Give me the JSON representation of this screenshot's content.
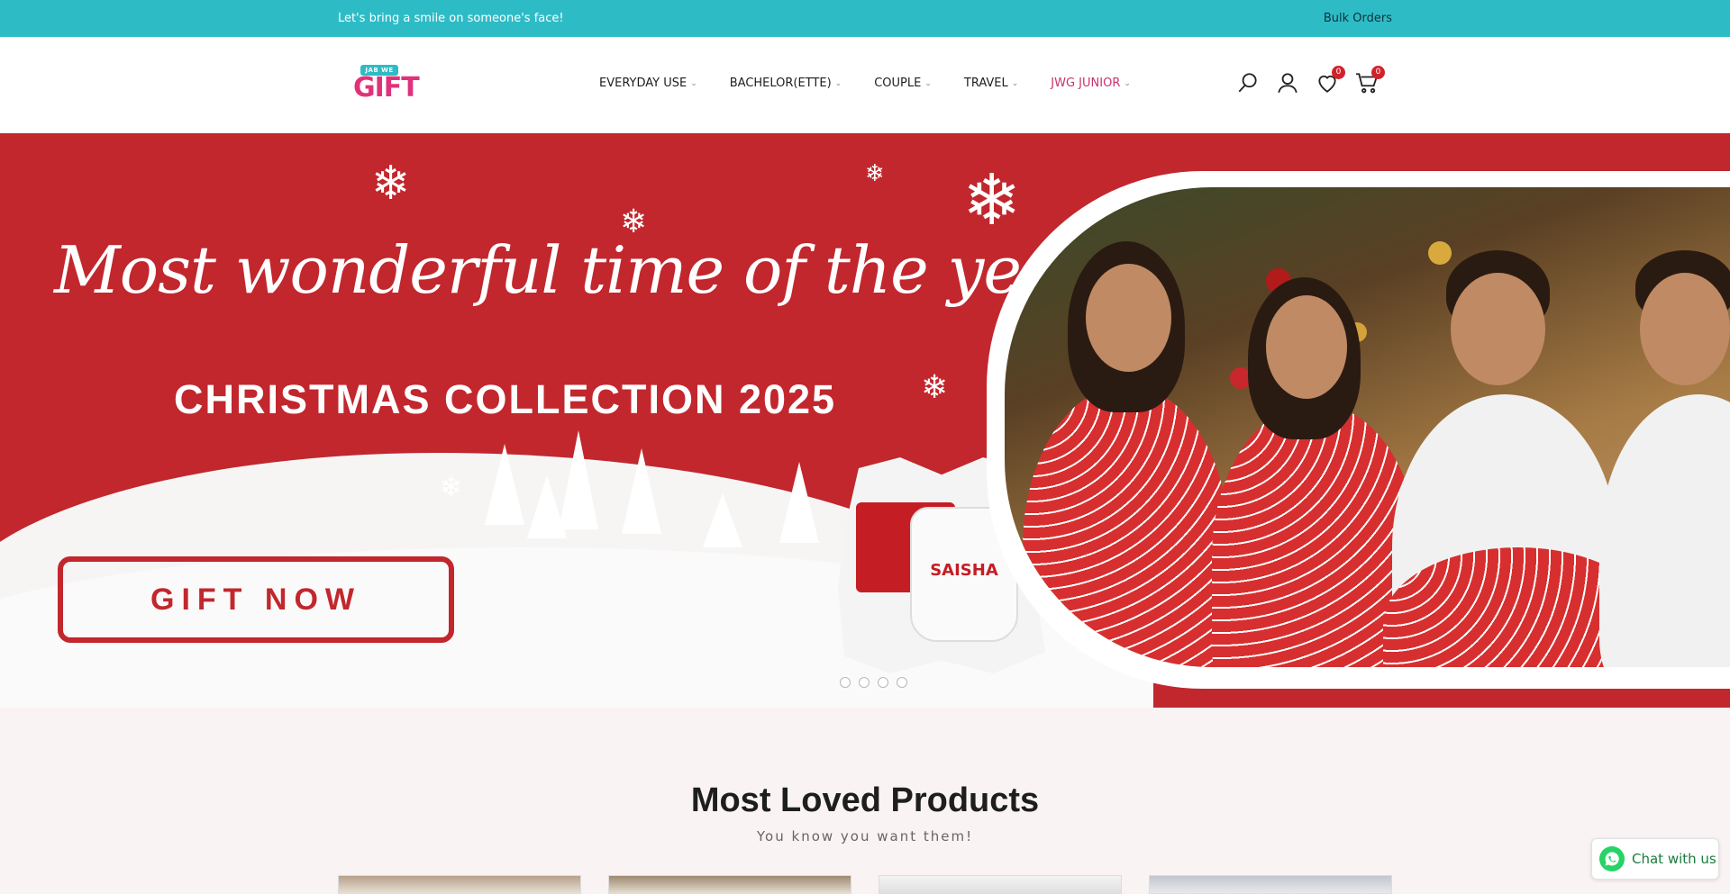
{
  "announcement": {
    "tagline": "Let's bring a smile on someone's face!",
    "bulk_orders": "Bulk Orders"
  },
  "header": {
    "logo_tag": "JAB WE",
    "logo_word": "GIFT",
    "nav": [
      {
        "label": "EVERYDAY USE"
      },
      {
        "label": "BACHELOR(ETTE)"
      },
      {
        "label": "COUPLE"
      },
      {
        "label": "TRAVEL"
      },
      {
        "label": "JWG JUNIOR"
      }
    ],
    "wishlist_count": "0",
    "cart_count": "0"
  },
  "hero": {
    "script_title": "Most wonderful time of the year",
    "collection": "CHRISTMAS COLLECTION 2025",
    "cta": "GIFT NOW",
    "mug_name": "SAISHA",
    "slides": 4,
    "active_slide": 1
  },
  "section": {
    "title": "Most Loved Products",
    "subtitle": "You know you want them!"
  },
  "chat": {
    "label": "Chat with us"
  },
  "colors": {
    "announcement_bg": "#2dbcc6",
    "hero_red": "#c1272d",
    "accent_pink": "#c8336c",
    "badge_red": "#d1222c",
    "whatsapp_green": "#25d366"
  }
}
